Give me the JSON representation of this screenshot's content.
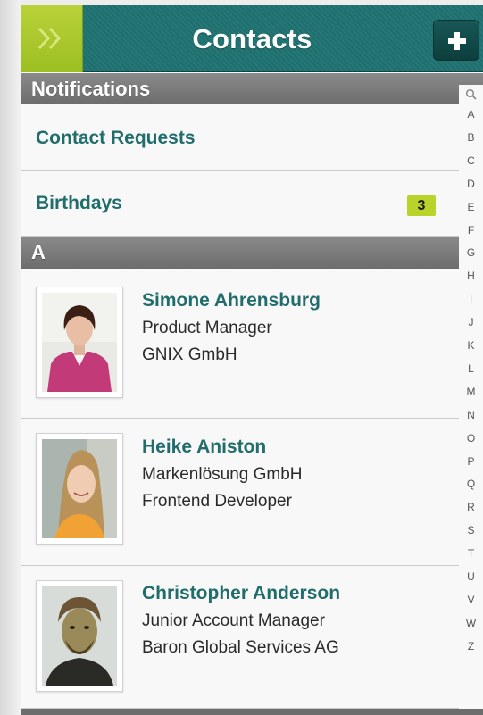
{
  "header": {
    "title": "Contacts",
    "menu_icon": "double-chevron-right-icon",
    "add_icon": "plus-icon"
  },
  "notifications": {
    "section_label": "Notifications",
    "rows": [
      {
        "label": "Contact Requests"
      },
      {
        "label": "Birthdays",
        "badge": "3"
      }
    ]
  },
  "contacts_section": {
    "label": "A",
    "contacts": [
      {
        "name": "Simone Ahrensburg",
        "line1": "Product Manager",
        "line2": "GNIX GmbH"
      },
      {
        "name": "Heike Aniston",
        "line1": "Markenlösung GmbH",
        "line2": "Frontend Developer"
      },
      {
        "name": "Christopher Anderson",
        "line1": "Junior Account Manager",
        "line2": "Baron Global Services AG"
      }
    ]
  },
  "index": {
    "search_icon": "search-icon",
    "letters": [
      "A",
      "B",
      "C",
      "D",
      "E",
      "F",
      "G",
      "H",
      "I",
      "J",
      "K",
      "L",
      "M",
      "N",
      "O",
      "P",
      "Q",
      "R",
      "S",
      "T",
      "U",
      "V",
      "W",
      "Z"
    ]
  },
  "colors": {
    "header_teal": "#247877",
    "accent_green": "#b9d32b",
    "name_teal": "#216d6c",
    "section_gray": "#7a7a7a"
  }
}
